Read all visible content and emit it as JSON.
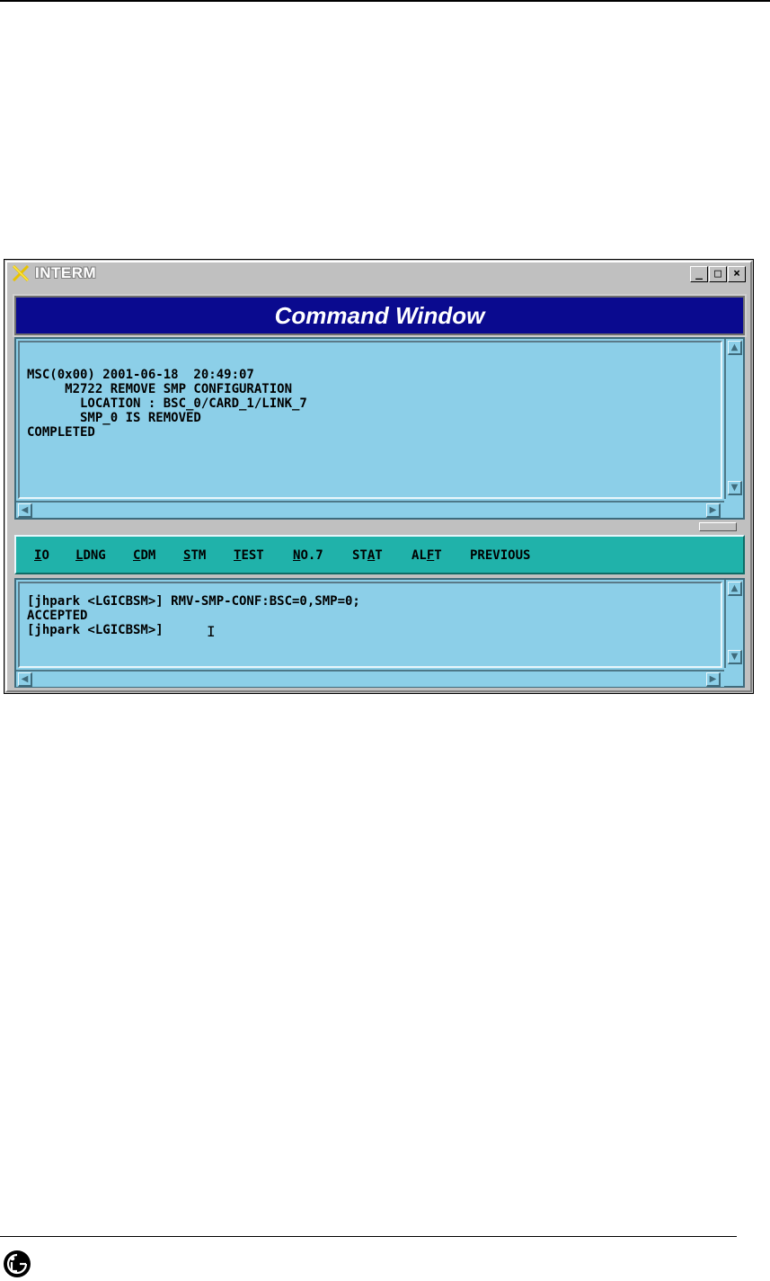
{
  "window": {
    "title": "INTERM",
    "minimize": "_",
    "maximize": "□",
    "close": "×",
    "header": "Command Window"
  },
  "output": {
    "lines": [
      "MSC(0x00) 2001-06-18  20:49:07",
      "     M2722 REMOVE SMP CONFIGURATION",
      "       LOCATION : BSC_0/CARD_1/LINK_7",
      "       SMP_0 IS REMOVED",
      "COMPLETED"
    ]
  },
  "menu": {
    "items": [
      "IO",
      "LDNG",
      "CDM",
      "STM",
      "TEST",
      "NO.7",
      "STAT",
      "ALFT",
      "PREVIOUS"
    ]
  },
  "input": {
    "lines": [
      "[jhpark <LGICBSM>] RMV-SMP-CONF:BSC=0,SMP=0;",
      "ACCEPTED",
      "[jhpark <LGICBSM>]"
    ]
  },
  "icons": {
    "window_icon": "x-logo-icon",
    "page_logo": "lg-logo-icon"
  }
}
